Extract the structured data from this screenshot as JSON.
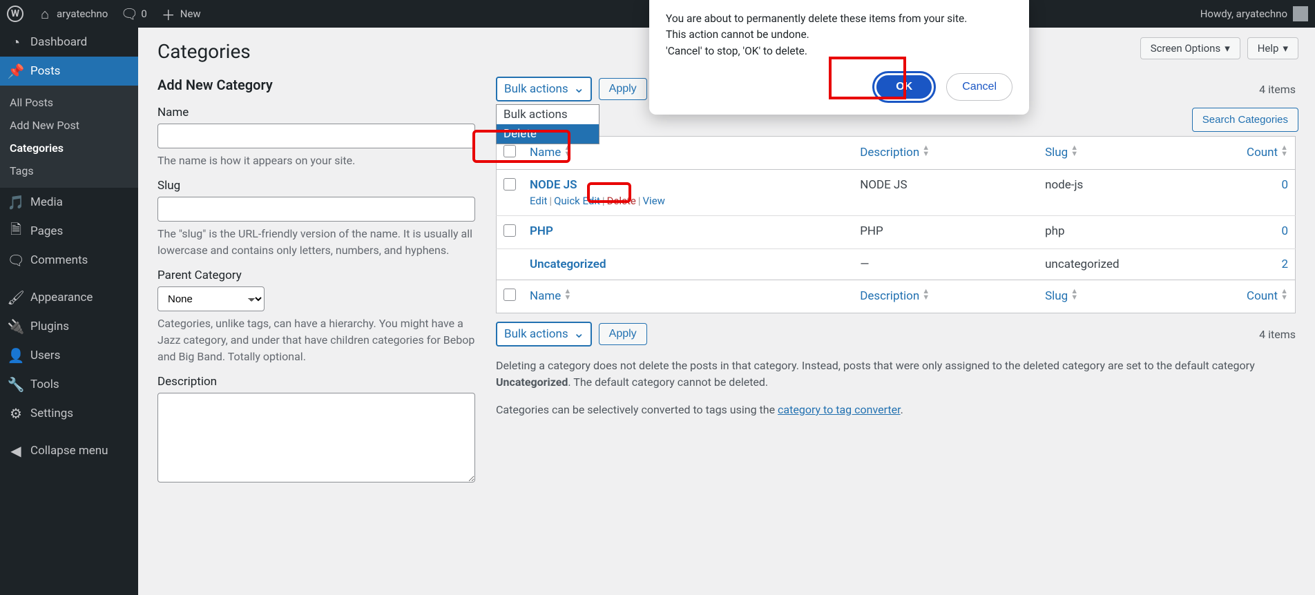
{
  "adminbar": {
    "site_name": "aryatechno",
    "comments_count": "0",
    "new_label": "New",
    "howdy": "Howdy, aryatechno"
  },
  "sidebar": {
    "dashboard": "Dashboard",
    "posts": "Posts",
    "posts_sub": {
      "all": "All Posts",
      "add": "Add New Post",
      "cats": "Categories",
      "tags": "Tags"
    },
    "media": "Media",
    "pages": "Pages",
    "comments": "Comments",
    "appearance": "Appearance",
    "plugins": "Plugins",
    "users": "Users",
    "tools": "Tools",
    "settings": "Settings",
    "collapse": "Collapse menu"
  },
  "screen": {
    "options": "Screen Options",
    "help": "Help"
  },
  "page": {
    "title": "Categories",
    "search_btn": "Search Categories"
  },
  "form": {
    "heading": "Add New Category",
    "name_label": "Name",
    "name_help": "The name is how it appears on your site.",
    "slug_label": "Slug",
    "slug_help": "The \"slug\" is the URL-friendly version of the name. It is usually all lowercase and contains only letters, numbers, and hyphens.",
    "parent_label": "Parent Category",
    "parent_value": "None",
    "parent_help": "Categories, unlike tags, can have a hierarchy. You might have a Jazz category, and under that have children categories for Bebop and Big Band. Totally optional.",
    "desc_label": "Description"
  },
  "bulk": {
    "selected": "Bulk actions",
    "opt_bulk": "Bulk actions",
    "opt_delete": "Delete",
    "apply": "Apply"
  },
  "table": {
    "items_count": "4 items",
    "cols": {
      "name": "Name",
      "desc": "Description",
      "slug": "Slug",
      "count": "Count"
    },
    "rows": [
      {
        "name": "NODE JS",
        "desc": "NODE JS",
        "slug": "node-js",
        "count": "0",
        "show_actions": true,
        "show_cb": true
      },
      {
        "name": "PHP",
        "desc": "PHP",
        "slug": "php",
        "count": "0",
        "show_actions": false,
        "show_cb": true
      },
      {
        "name": "Uncategorized",
        "desc": "—",
        "slug": "uncategorized",
        "count": "2",
        "show_actions": false,
        "show_cb": false
      }
    ],
    "actions": {
      "edit": "Edit",
      "quick": "Quick Edit",
      "del": "Delete",
      "view": "View"
    }
  },
  "notes": {
    "l1a": "Deleting a category does not delete the posts in that category. Instead, posts that were only assigned to the deleted category are set to the default category ",
    "l1b": "Uncategorized",
    "l1c": ". The default category cannot be deleted.",
    "l2a": "Categories can be selectively converted to tags using the ",
    "l2b": "category to tag converter",
    "l2c": "."
  },
  "dialog": {
    "l1": "You are about to permanently delete these items from your site.",
    "l2": "This action cannot be undone.",
    "l3": "'Cancel' to stop, 'OK' to delete.",
    "ok": "OK",
    "cancel": "Cancel"
  }
}
